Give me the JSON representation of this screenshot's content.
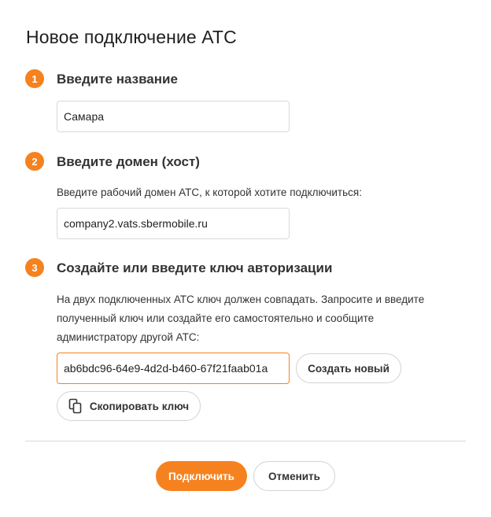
{
  "dialog": {
    "title": "Новое подключение АТС"
  },
  "steps": [
    {
      "number": "1",
      "title": "Введите название",
      "input_value": "Самара"
    },
    {
      "number": "2",
      "title": "Введите домен (хост)",
      "hint": "Введите рабочий домен АТС, к которой хотите подключиться:",
      "input_value": "company2.vats.sbermobile.ru"
    },
    {
      "number": "3",
      "title": "Создайте или введите ключ авторизации",
      "hint_lines": [
        "На двух подключенных АТС ключ должен совпадать. Запросите и введите",
        "полученный ключ или создайте его самостоятельно и сообщите",
        "администратору другой АТС:"
      ],
      "input_value": "ab6bdc96-64e9-4d2d-b460-67f21faab01a",
      "create_button": "Создать новый",
      "copy_button": "Скопировать ключ",
      "copy_icon": "copy-icon"
    }
  ],
  "footer": {
    "connect_button": "Подключить",
    "cancel_button": "Отменить"
  },
  "colors": {
    "accent": "#f5821f",
    "border": "#d9d9d9",
    "text": "#333333"
  }
}
